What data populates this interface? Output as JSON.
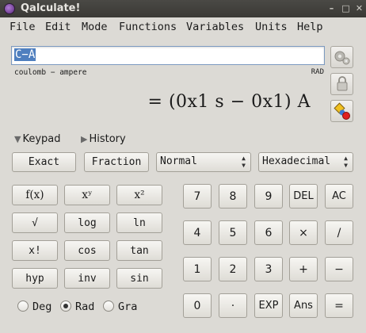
{
  "window": {
    "title": "Qalculate!"
  },
  "window_controls": {
    "minimize": "–",
    "maximize": "□",
    "close": "✕"
  },
  "menu": [
    "File",
    "Edit",
    "Mode",
    "Functions",
    "Variables",
    "Units",
    "Help"
  ],
  "expression": {
    "value": "C−A"
  },
  "status": {
    "left": "coulomb − ampere",
    "right": "RAD"
  },
  "result": {
    "text": "= (0x1 s − 0x1) A"
  },
  "toggles": {
    "keypad": "Keypad",
    "history": "History"
  },
  "buttons": {
    "exact": "Exact",
    "fraction": "Fraction"
  },
  "selects": {
    "mode": "Normal",
    "base": "Hexadecimal"
  },
  "functions": [
    [
      "f(x)",
      "xʸ",
      "x²"
    ],
    [
      "√",
      "log",
      "ln"
    ],
    [
      "x!",
      "cos",
      "tan"
    ],
    [
      "hyp",
      "inv",
      "sin"
    ]
  ],
  "keys": [
    [
      "7",
      "8",
      "9",
      "DEL",
      "AC"
    ],
    [
      "4",
      "5",
      "6",
      "×",
      "/"
    ],
    [
      "1",
      "2",
      "3",
      "+",
      "−"
    ],
    [
      "0",
      "·",
      "EXP",
      "Ans",
      "="
    ]
  ],
  "angle_units": {
    "options": [
      "Deg",
      "Rad",
      "Gra"
    ],
    "selected": "Rad"
  },
  "colors": {
    "titlebar": "#3c3b37",
    "accent": "#4f7fbf",
    "background": "#dcdad5"
  }
}
